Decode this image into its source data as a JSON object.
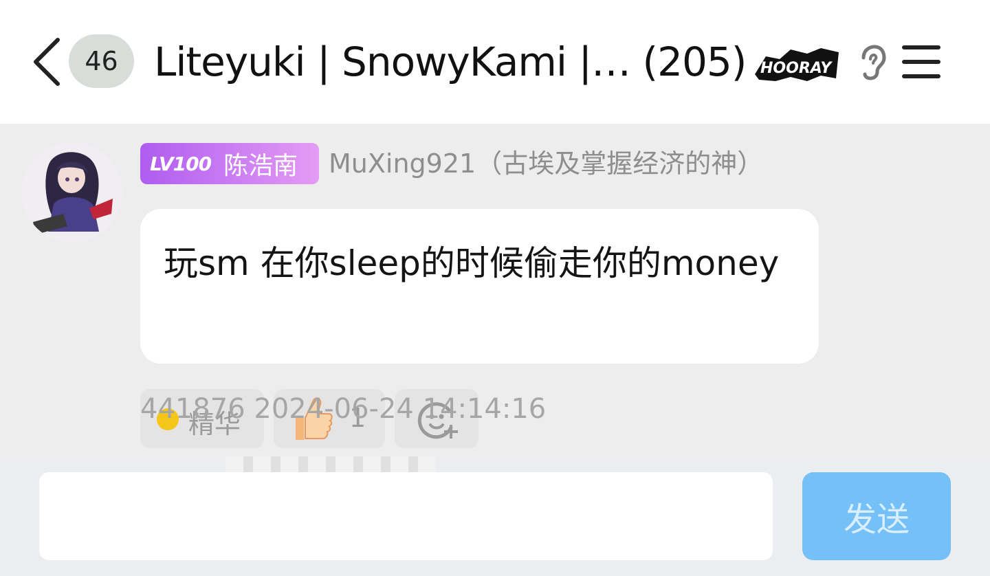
{
  "header": {
    "unread_count": "46",
    "title": "Liteyuki | SnowyKami |… (205)",
    "badge_text": "HOORAY"
  },
  "message": {
    "level": "LV100",
    "level_name": "陈浩南",
    "sender": "MuXing921（古埃及掌握经济的神）",
    "text": "玩sm 在你sleep的时候偷走你的money",
    "meta": "441876  2024-06-24 14:14:16"
  },
  "reactions": [
    {
      "icon": "essence-dot-icon",
      "label": "精华"
    },
    {
      "icon": "thumbs-up-icon",
      "count": "1"
    },
    {
      "icon": "add-reaction-icon"
    }
  ],
  "composer": {
    "input_value": "",
    "send_label": "发送"
  },
  "colors": {
    "level_badge_start": "#b05cf0",
    "level_badge_end": "#e49cf4",
    "send_button": "#74c0f7",
    "bubble": "#ffffff",
    "background": "#ededed"
  }
}
